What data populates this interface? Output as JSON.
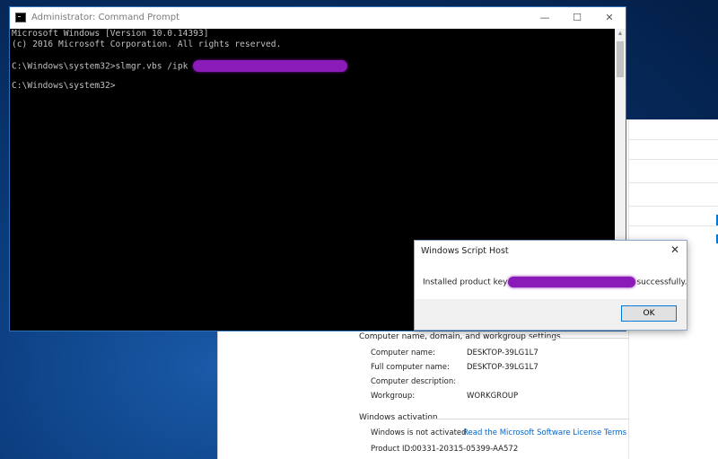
{
  "cmd": {
    "title": "Administrator: Command Prompt",
    "controls": {
      "minimize": "—",
      "maximize": "☐",
      "close": "✕"
    },
    "lines": [
      "Microsoft Windows [Version 10.0.14393]",
      "(c) 2016 Microsoft Corporation. All rights reserved.",
      "",
      "C:\\Windows\\system32>slmgr.vbs /ipk ",
      "",
      "C:\\Windows\\system32>"
    ]
  },
  "dialog": {
    "title": "Windows Script Host",
    "close": "✕",
    "message_prefix": "Installed product key",
    "message_suffix": "successfully.",
    "ok_label": "OK"
  },
  "system": {
    "computer_section_title": "Computer name, domain, and workgroup settings",
    "rows": [
      {
        "label": "Computer name:",
        "value": "DESKTOP-39LG1L7"
      },
      {
        "label": "Full computer name:",
        "value": "DESKTOP-39LG1L7"
      },
      {
        "label": "Computer description:",
        "value": ""
      },
      {
        "label": "Workgroup:",
        "value": "WORKGROUP"
      }
    ],
    "activation_section_title": "Windows activation",
    "activation_status": "Windows is not activated.",
    "license_link": "Read the Microsoft Software License Terms",
    "product_id_label": "Product ID:",
    "product_id_value": "00331-20315-05399-AA572"
  },
  "colors": {
    "accent": "#0078d7",
    "redaction": "#8a1bb8",
    "link": "#0066cc"
  }
}
